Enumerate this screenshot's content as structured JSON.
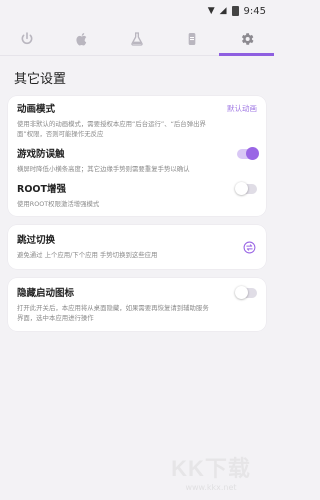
{
  "status_bar": {
    "time": "9:45",
    "wifi_icon": "wifi-icon",
    "signal_icon": "signal-icon",
    "battery_icon": "battery-icon"
  },
  "tabs": [
    {
      "icon": "power-icon",
      "active": false
    },
    {
      "icon": "apple-icon",
      "active": false
    },
    {
      "icon": "flask-icon",
      "active": false
    },
    {
      "icon": "phone-icon",
      "active": false
    },
    {
      "icon": "gear-icon",
      "active": true
    }
  ],
  "colors": {
    "accent": "#9a66e5",
    "accent_text": "#a27be4",
    "background": "#f3f2f5"
  },
  "page_title": "其它设置",
  "animation": {
    "title": "动画模式",
    "value": "默认动画",
    "desc": "使用非默认的动画模式，需要授权本应用“后台运行”、“后台弹出界面”权限，否则可能操作无反应"
  },
  "game_guard": {
    "title": "游戏防误触",
    "desc": "横屏时降低小横条高度；其它边缘手势则需要重复手势以确认",
    "enabled": true
  },
  "root": {
    "title": "ROOT增强",
    "desc": "使用ROOT权限激活增强模式",
    "enabled": false
  },
  "skip_switch": {
    "title": "跳过切换",
    "desc": "避免通过 上个应用/下个应用 手势切换到这些应用",
    "icon": "swap-icon"
  },
  "hide_launcher": {
    "title": "隐藏启动图标",
    "desc": "打开此开关后，本应用将从桌面隐藏，如果需要再恢复请到辅助服务界面，选中本应用进行操作",
    "enabled": false
  },
  "watermark": {
    "brand": "KK下载",
    "url": "www.kkx.net"
  }
}
